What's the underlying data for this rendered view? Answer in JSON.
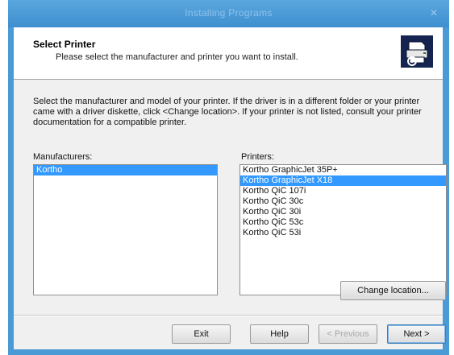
{
  "window": {
    "title": "Installing Programs",
    "close_glyph": "✕"
  },
  "header": {
    "title": "Select Printer",
    "subtitle": "Please select the manufacturer and printer you want to install.",
    "icon": "printer-install-icon"
  },
  "description": "Select the manufacturer and model of your printer. If the driver is in a different folder or your printer came with a driver diskette, click <Change location>. If your printer is not listed, consult your printer documentation for a compatible printer.",
  "manufacturers": {
    "label": "Manufacturers:",
    "items": [
      "Kortho"
    ],
    "selected": "Kortho"
  },
  "printers": {
    "label": "Printers:",
    "items": [
      "Kortho GraphicJet 35P+",
      "Kortho GraphicJet X18",
      "Kortho QiC 107i",
      "Kortho QiC 30c",
      "Kortho QiC 30i",
      "Kortho QiC 53c",
      "Kortho QiC 53i"
    ],
    "selected": "Kortho GraphicJet X18"
  },
  "buttons": {
    "change_location": "Change location...",
    "exit": "Exit",
    "help": "Help",
    "previous": "< Previous",
    "next": "Next >"
  }
}
